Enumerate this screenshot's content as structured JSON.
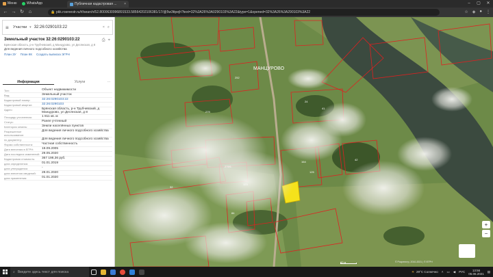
{
  "browser": {
    "bookmarks": [
      {
        "label": "Меню",
        "color": "#e6a24a"
      },
      {
        "label": "WhatsApp",
        "color": "#25d366"
      }
    ],
    "tab_title": "Публичная кадастровая ...",
    "url": "pkk.rosreestr.ru/#/search/52.8000630996891533.58564202106381/17/@5w3ttpejh?text=32%3A26%3A0290103%3A22&type=1&opened=32%3A26%3A290103%3A22"
  },
  "search": {
    "mode": "Участки",
    "value": "32:26:0290103:22"
  },
  "object": {
    "title": "Земельный участок 32:26:0290103:22",
    "address_short": "Брянская область, р-н Трубчевский, д Манцурово, ул Десянская, д 8",
    "use": "Для ведения личного подсобного хозяйства",
    "links": [
      "План ЗУ",
      "План КК",
      "Создать выписка ЭГРН"
    ]
  },
  "tabs": [
    "Информация",
    "Услуги"
  ],
  "props": [
    {
      "k": "Тип:",
      "v": "Объект недвижимости"
    },
    {
      "k": "Вид:",
      "v": "Земельный участок"
    },
    {
      "k": "Кадастровый номер:",
      "v": "32:26:0290103:22",
      "link": true
    },
    {
      "k": "Кадастровый квартал:",
      "v": "32:26:0290103",
      "link": true
    },
    {
      "k": "Адрес:",
      "v": "Брянская область, р-н Трубчевский, д Манцурово, ул Десянская, д 8"
    },
    {
      "k": "Площадь уточненная:",
      "v": "1 811 кв. м"
    },
    {
      "k": "Статус:",
      "v": "Ранее учтенный"
    },
    {
      "k": "Категория земель:",
      "v": "Земли населённых пунктов"
    },
    {
      "k": "Разрешенное использование:",
      "v": "Для ведения личного подсобного хозяйства"
    },
    {
      "k": "по документу:",
      "v": "Для ведения личного подсобного хозяйства"
    },
    {
      "k": "Форма собственности:",
      "v": "Частная собственность"
    },
    {
      "k": "Дата внесения в ЕГРН:",
      "v": "19.09.2005"
    },
    {
      "k": "Дата последних изменений:",
      "v": "29.05.2020"
    },
    {
      "k": "Кадастровая стоимость:",
      "v": "367 198,36 руб."
    },
    {
      "k": "дата определения:",
      "v": "01.01.2019"
    },
    {
      "k": "дата утверждения:",
      "v": "-"
    },
    {
      "k": "дата внесения сведений:",
      "v": "28.01.2020"
    },
    {
      "k": "дата применения:",
      "v": "01.01.2020"
    }
  ],
  "map": {
    "village": "МАНЦУРОВО",
    "scale": "60 м",
    "source": "© Росреестр, 2010-2021 | © ЕГРН",
    "parcel_labels": [
      "279",
      "252",
      "164",
      "125",
      "41",
      "24",
      "42",
      "279/1",
      "123",
      "84",
      "32"
    ]
  },
  "taskbar": {
    "search_placeholder": "Введите здесь текст для поиска",
    "weather": "29°C Солнечно",
    "lang": "РУС",
    "time": "13:56",
    "date": "05.06.2021"
  },
  "colors": {
    "parcel_line": "#e02020",
    "selected_fill": "#f5e21b",
    "link": "#2d6bb3",
    "river": "#3b4a3f"
  }
}
